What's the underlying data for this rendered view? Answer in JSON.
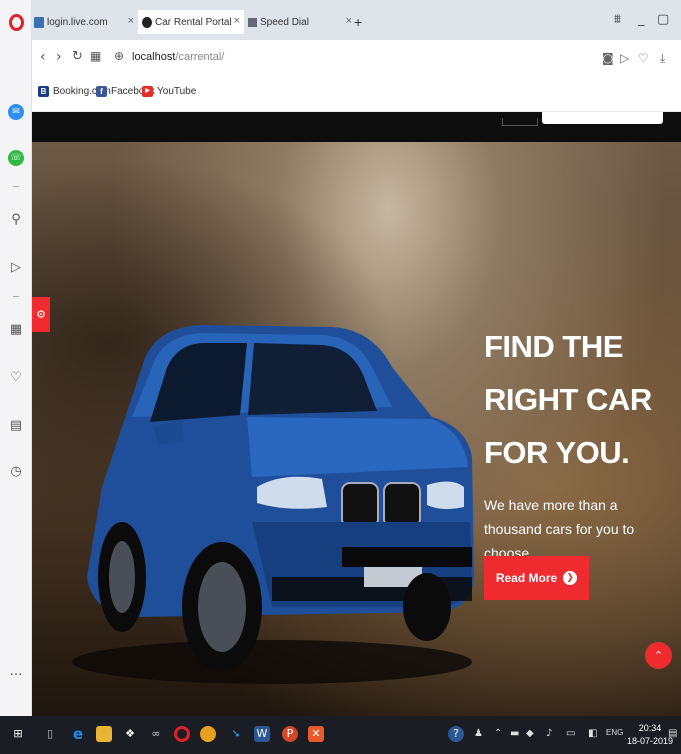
{
  "browser": {
    "tabs": [
      {
        "label": "login.live.com",
        "active": false
      },
      {
        "label": "Car Rental Portal",
        "active": true
      },
      {
        "label": "Speed Dial",
        "active": false
      }
    ],
    "new_tab_label": "+",
    "address": {
      "host": "localhost",
      "path": "/carrental/"
    },
    "bookmarks": [
      {
        "label": "Booking.com",
        "icon": "B"
      },
      {
        "label": "Facebook",
        "icon": "f"
      },
      {
        "label": "YouTube",
        "icon": "▶"
      }
    ]
  },
  "hero": {
    "headline": [
      "FIND THE",
      "RIGHT CAR",
      "FOR YOU."
    ],
    "subtext": "We have more than a thousand cars for you to choose.",
    "cta_label": "Read More"
  },
  "taskbar": {
    "lang": "ENG",
    "time": "20:34",
    "date": "18-07-2019"
  },
  "colors": {
    "accent": "#ef2b2f",
    "opera": "#e0202b"
  }
}
